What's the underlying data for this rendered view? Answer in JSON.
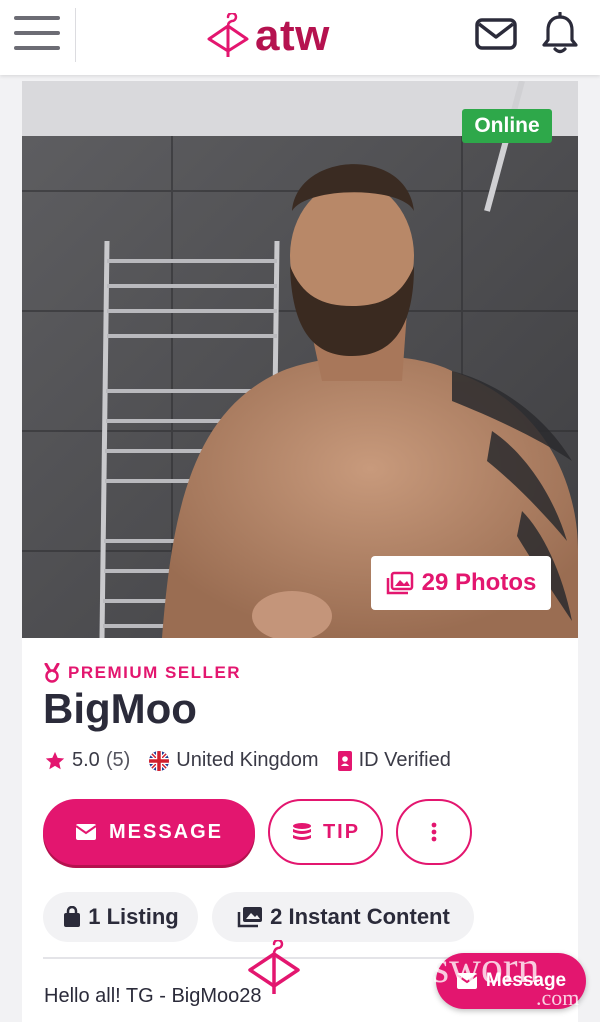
{
  "header": {
    "logo_text": "atw",
    "icons": {
      "menu": "hamburger-icon",
      "mail": "mail-icon",
      "notifications": "bell-icon"
    }
  },
  "profile": {
    "status_badge": "Online",
    "photos_label": "29 Photos",
    "premium_label": "PREMIUM SELLER",
    "name": "BigMoo",
    "rating": "5.0",
    "rating_count": "(5)",
    "country": "United Kingdom",
    "verified": "ID Verified",
    "buttons": {
      "message": "MESSAGE",
      "tip": "TIP",
      "more": "more-options"
    },
    "chips": {
      "listing": "1 Listing",
      "instant": "2 Instant Content"
    },
    "bio": "Hello all! TG - BigMoo28"
  },
  "floating": {
    "message": "Message"
  },
  "watermark": {
    "text": "gsworn",
    "suffix": ".com"
  },
  "colors": {
    "brand": "#e3166f",
    "logo": "#b5124f",
    "online": "#2ea84a"
  }
}
